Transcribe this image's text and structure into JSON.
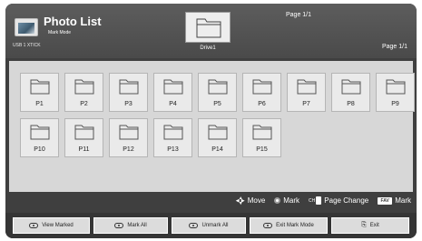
{
  "header": {
    "app_title": "Photo List",
    "mode_label": "Mark Mode",
    "device_label": "USB 1 XTICK",
    "current_folder_label": "Drive1",
    "page_indicator_top": "Page 1/1",
    "page_indicator_right": "Page 1/1"
  },
  "folders": [
    {
      "label": "P1"
    },
    {
      "label": "P2"
    },
    {
      "label": "P3"
    },
    {
      "label": "P4"
    },
    {
      "label": "P5"
    },
    {
      "label": "P6"
    },
    {
      "label": "P7"
    },
    {
      "label": "P8"
    },
    {
      "label": "P9"
    },
    {
      "label": "P10"
    },
    {
      "label": "P11"
    },
    {
      "label": "P12"
    },
    {
      "label": "P13"
    },
    {
      "label": "P14"
    },
    {
      "label": "P15"
    }
  ],
  "hints": {
    "move": "Move",
    "mark": "Mark",
    "page_change": "Page Change",
    "fav_key": "FAV",
    "fav_mark": "Mark"
  },
  "buttons": {
    "view_marked": "View Marked",
    "mark_all": "Mark All",
    "unmark_all": "Unmark All",
    "exit_mark_mode": "Exit Mark Mode",
    "exit": "Exit"
  }
}
